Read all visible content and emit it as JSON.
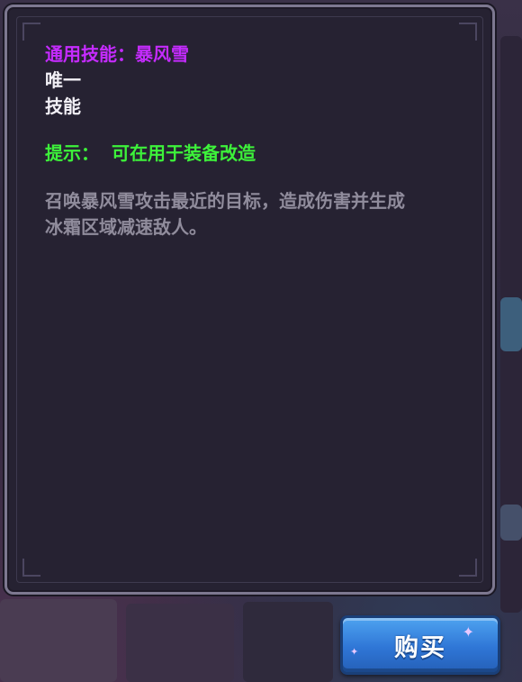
{
  "tooltip": {
    "skill_title": "通用技能：暴风雪",
    "tag_unique": "唯一",
    "tag_type": "技能",
    "hint_label": "提示：",
    "hint_text": "可在用于装备改造",
    "description_line1": "召唤暴风雪攻击最近的目标，造成伤害并生成",
    "description_line2": "冰霜区域减速敌人。"
  },
  "buy_button": {
    "label": "购买"
  },
  "colors": {
    "skill_title": "#c52bff",
    "hint": "#3df23a",
    "description": "#908c9c",
    "panel_bg": "#262232",
    "button_blue": "#2f76d6"
  }
}
